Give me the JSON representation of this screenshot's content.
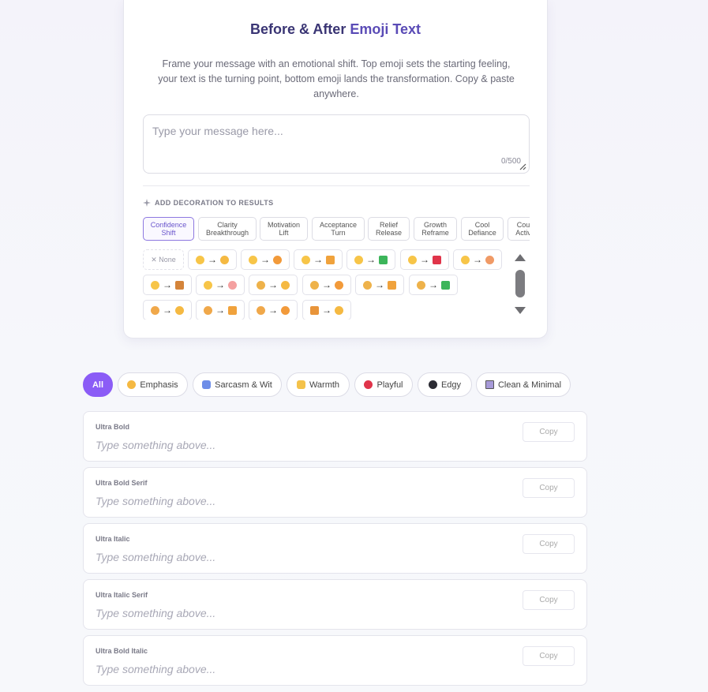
{
  "header": {
    "title_main": "Before & After",
    "title_accent": "Emoji Text",
    "description": "Frame your message with an emotional shift. Top emoji sets the starting feeling, your text is the turning point, bottom emoji lands the transformation. Copy & paste anywhere."
  },
  "message": {
    "placeholder": "Type your message here...",
    "value": "",
    "counter": "0/500"
  },
  "decoration": {
    "label": "ADD DECORATION TO RESULTS",
    "tabs": [
      {
        "label": "Confidence\nShift",
        "active": true
      },
      {
        "label": "Clarity\nBreakthrough"
      },
      {
        "label": "Motivation\nLift"
      },
      {
        "label": "Acceptance\nTurn"
      },
      {
        "label": "Relief\nRelease"
      },
      {
        "label": "Growth\nReframe"
      },
      {
        "label": "Cool\nDefiance"
      },
      {
        "label": "Cou\nActiv"
      }
    ],
    "none_label": "✕ None",
    "arrow": "→"
  },
  "filters": [
    {
      "label": "All",
      "active": true
    },
    {
      "label": "Emphasis",
      "icon": "flexed-arm-icon",
      "color": "#f5b942"
    },
    {
      "label": "Sarcasm & Wit",
      "icon": "masks-icon",
      "color": "#6e8ee8"
    },
    {
      "label": "Warmth",
      "icon": "sparkle-icon",
      "color": "#f4c24a"
    },
    {
      "label": "Playful",
      "icon": "balloon-icon",
      "color": "#e0344a"
    },
    {
      "label": "Edgy",
      "icon": "black-heart-icon",
      "color": "#2b2b33"
    },
    {
      "label": "Clean & Minimal",
      "icon": "square-icon",
      "color": "#a79ad8"
    }
  ],
  "results": [
    {
      "name": "Ultra Bold",
      "preview": "Type something above...",
      "copy": "Copy"
    },
    {
      "name": "Ultra Bold Serif",
      "preview": "Type something above...",
      "copy": "Copy"
    },
    {
      "name": "Ultra Italic",
      "preview": "Type something above...",
      "copy": "Copy"
    },
    {
      "name": "Ultra Italic Serif",
      "preview": "Type something above...",
      "copy": "Copy"
    },
    {
      "name": "Ultra Bold Italic",
      "preview": "Type something above...",
      "copy": "Copy"
    }
  ],
  "colors": {
    "accent": "#8b5cf6",
    "title": "#3a3574",
    "emoji_face": "#f7c548"
  }
}
